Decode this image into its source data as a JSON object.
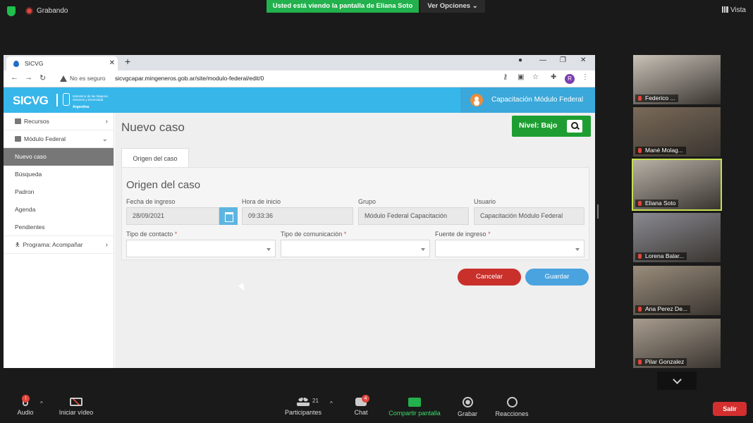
{
  "zoom": {
    "recording_label": "Grabando",
    "share_banner": "Usted está viendo la pantalla de Eliana Soto",
    "view_options": "Ver Opciones",
    "view_label": "Vista"
  },
  "browser": {
    "tab_title": "SICVG",
    "security_label": "No es seguro",
    "url": "sicvgcapar.mingeneros.gob.ar/site/modulo-federal/edit/0",
    "profile_initial": "R"
  },
  "site": {
    "logo": "SICVG",
    "ministry": "Ministerio de las Mujeres, Géneros y Diversidad",
    "country": "Argentina",
    "user_name": "Capacitación Módulo Federal"
  },
  "sidebar": {
    "items": [
      {
        "label": "Recursos"
      },
      {
        "label": "Módulo Federal"
      },
      {
        "label": "Nuevo caso"
      },
      {
        "label": "Búsqueda"
      },
      {
        "label": "Padron"
      },
      {
        "label": "Agenda"
      },
      {
        "label": "Pendientes"
      },
      {
        "label": "Programa: Acompañar"
      }
    ]
  },
  "main": {
    "title": "Nuevo caso",
    "nivel": "Nivel: Bajo",
    "tab_label": "Origen del caso",
    "panel_title": "Origen del caso",
    "fields": {
      "fecha_label": "Fecha de ingreso",
      "fecha_value": "28/09/2021",
      "hora_label": "Hora de inicio",
      "hora_value": "09:33:36",
      "grupo_label": "Grupo",
      "grupo_value": "Módulo Federal Capacitación",
      "usuario_label": "Usuario",
      "usuario_value": "Capacitación  Módulo Federal",
      "contacto_label": "Tipo de contacto",
      "comunicacion_label": "Tipo de comunicación",
      "fuente_label": "Fuente de ingreso",
      "required_mark": "*"
    },
    "cancel_label": "Cancelar",
    "save_label": "Guardar"
  },
  "participants": [
    {
      "name": "Federico ...",
      "color": "#c8c2b8"
    },
    {
      "name": "Mané Molag...",
      "color": "#7a6a58"
    },
    {
      "name": "Eliana Soto",
      "color": "#b6b0a6"
    },
    {
      "name": "Lorena Balar...",
      "color": "#8a8a92"
    },
    {
      "name": "Ana Perez De...",
      "color": "#9a8d7c"
    },
    {
      "name": "Pilar Gonzalez",
      "color": "#a89c8e"
    }
  ],
  "toolbar": {
    "audio": "Audio",
    "audio_badge": "!",
    "video": "Iniciar vídeo",
    "participants": "Participantes",
    "participants_count": "21",
    "chat": "Chat",
    "chat_badge": "4",
    "share": "Compartir pantalla",
    "record": "Grabar",
    "reactions": "Reacciones",
    "leave": "Salir"
  },
  "colors": {
    "share_green": "#22b14c",
    "site_blue": "#37b6ea",
    "nivel_green": "#1e9e32",
    "cancel_red": "#c9302c",
    "save_blue": "#4aa3df",
    "leave_red": "#d32f2f"
  }
}
